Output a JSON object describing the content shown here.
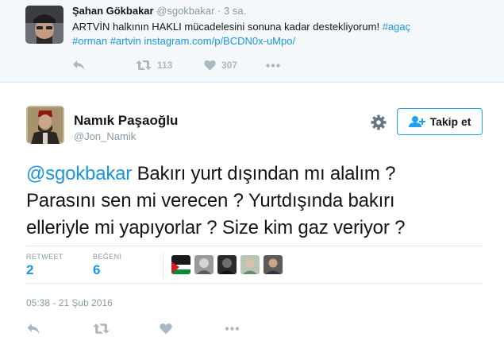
{
  "parent_tweet": {
    "author_name": "Şahan Gökbakar",
    "handle": "@sgokbakar",
    "separator": "·",
    "time": "3 sa.",
    "text_plain": "ARTVİN halkının HAKLI mücadelesini sonuna kadar destekliyorum!",
    "hashtag_1": "#agaç",
    "hashtag_2": "#orman",
    "hashtag_3": "#artvin",
    "link": "instagram.com/p/BCDN0x-uMpo/",
    "retweet_count": "113",
    "like_count": "307"
  },
  "main_tweet": {
    "author_name": "Namık Paşaoğlu",
    "handle": "@Jon_Namik",
    "follow_label": "Takip et",
    "mention": "@sgokbakar",
    "text_line_1": "Bakırı yurt dışından mı alalım ?",
    "text_line_2": "Parasını sen mi verecen ? Yurtdışında bakırı",
    "text_line_3": "elleriyle mi yapıyorlar ? Size kim gaz veriyor ?",
    "retweet_label": "RETWEET",
    "retweet_count": "2",
    "like_label": "BEĞENİ",
    "like_count": "6",
    "timestamp": "05:38 - 21 Şub 2016"
  },
  "colors": {
    "accent": "#1da1f2",
    "link": "#1b95e0",
    "muted": "#8899a6",
    "icon": "#aab8c2",
    "parent_bg": "#f5f8fa"
  },
  "icons": [
    "reply-icon",
    "retweet-icon",
    "heart-icon",
    "more-icon",
    "gear-icon",
    "follow-user-plus-icon"
  ]
}
